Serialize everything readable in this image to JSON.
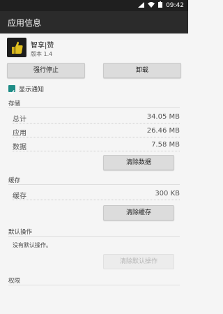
{
  "status_bar": {
    "time": "09:42"
  },
  "app_bar": {
    "title": "应用信息"
  },
  "app": {
    "name": "智享|赞",
    "version": "版本 1.4"
  },
  "buttons": {
    "force_stop": "强行停止",
    "uninstall": "卸载",
    "clear_data": "清除数据",
    "clear_cache": "清除缓存",
    "clear_defaults": "清除默认操作"
  },
  "notifications": {
    "label": "显示通知",
    "checked": true
  },
  "storage": {
    "title": "存储",
    "rows": [
      {
        "label": "总计",
        "value": "34.05 MB"
      },
      {
        "label": "应用",
        "value": "26.46 MB"
      },
      {
        "label": "数据",
        "value": "7.58 MB"
      }
    ]
  },
  "cache": {
    "title": "缓存",
    "rows": [
      {
        "label": "缓存",
        "value": "300 KB"
      }
    ]
  },
  "defaults": {
    "title": "默认操作",
    "text": "没有默认操作。"
  },
  "permissions": {
    "title": "权限"
  },
  "colors": {
    "accent": "#1e8c86",
    "app_bar": "#2b2b2b",
    "status_bar": "#1f1f1f"
  }
}
